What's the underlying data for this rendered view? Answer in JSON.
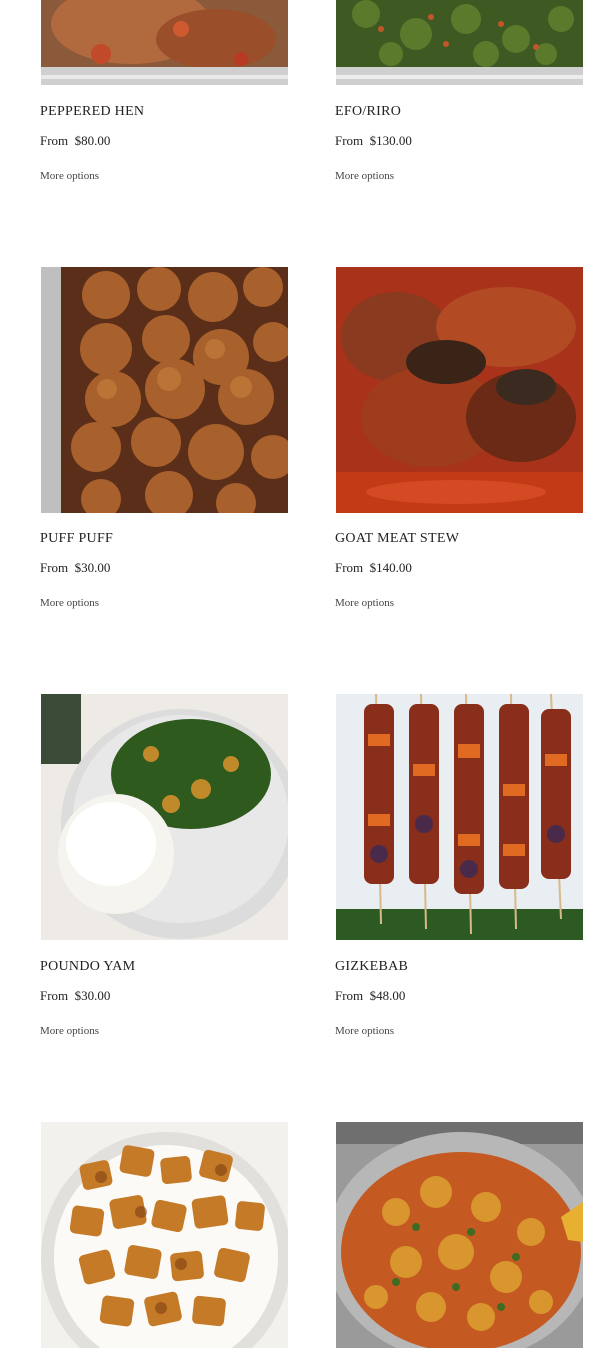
{
  "products": [
    {
      "name": "PEPPERED HEN",
      "price_prefix": "From",
      "price": "$80.00",
      "more": "More options",
      "image": "peppered-hen-photo"
    },
    {
      "name": "EFO/RIRO",
      "price_prefix": "From",
      "price": "$130.00",
      "more": "More options",
      "image": "efo-riro-photo"
    },
    {
      "name": "PUFF PUFF",
      "price_prefix": "From",
      "price": "$30.00",
      "more": "More options",
      "image": "puff-puff-photo"
    },
    {
      "name": "GOAT MEAT STEW",
      "price_prefix": "From",
      "price": "$140.00",
      "more": "More options",
      "image": "goat-meat-stew-photo"
    },
    {
      "name": "POUNDO YAM",
      "price_prefix": "From",
      "price": "$30.00",
      "more": "More options",
      "image": "poundo-yam-photo"
    },
    {
      "name": "GIZKEBAB",
      "price_prefix": "From",
      "price": "$48.00",
      "more": "More options",
      "image": "gizkebab-photo"
    },
    {
      "name": "",
      "price_prefix": "",
      "price": "",
      "more": "",
      "image": "fried-plantain-photo"
    },
    {
      "name": "",
      "price_prefix": "",
      "price": "",
      "more": "",
      "image": "egusi-soup-photo"
    }
  ]
}
